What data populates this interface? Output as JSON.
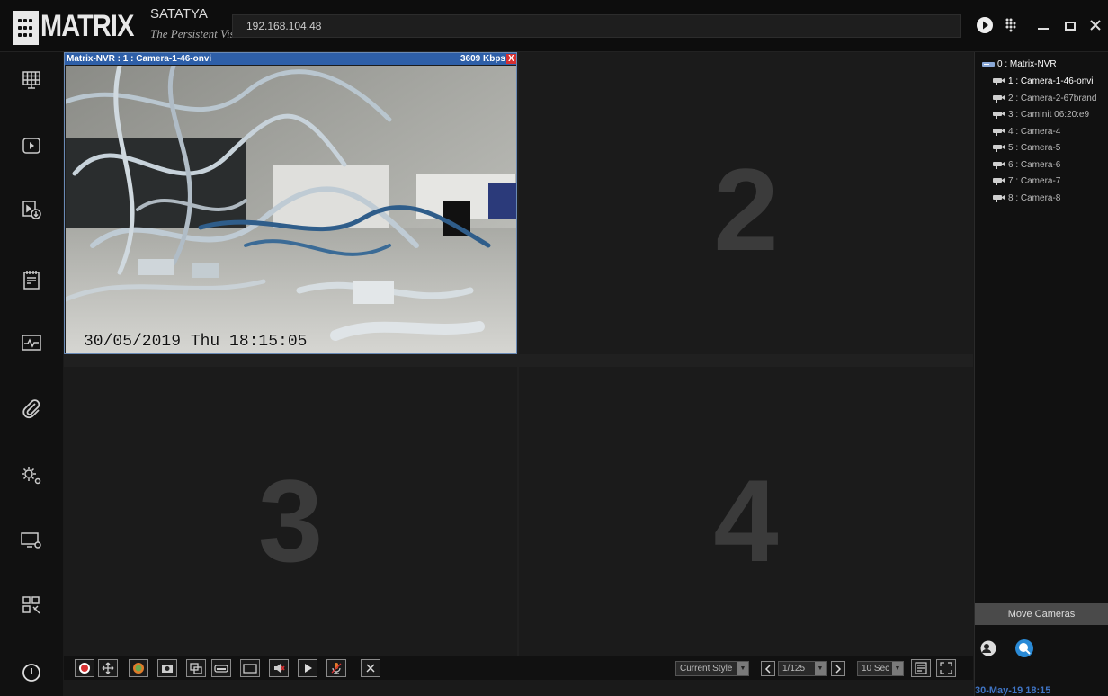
{
  "header": {
    "brand": "SATATYA",
    "tagline": "The Persistent Vision",
    "logo": "MATRIX",
    "address": "192.168.104.48",
    "icons": [
      "play-icon",
      "grid-dots-icon",
      "minimize-icon",
      "restore-icon",
      "close-icon"
    ]
  },
  "sidebar": {
    "items": [
      "live-view-icon",
      "playback-icon",
      "video-download-icon",
      "event-log-icon",
      "system-health-icon",
      "attachment-icon",
      "settings-icon",
      "display-settings-icon",
      "layout-tools-icon",
      "power-icon"
    ]
  },
  "tiles": {
    "t1": {
      "title": "Matrix-NVR : 1 : Camera-1-46-onvi",
      "kbps": "3609 Kbps",
      "close": "X",
      "timestamp": "30/05/2019 Thu 18:15:05"
    },
    "t2": "2",
    "t3": "3",
    "t4": "4"
  },
  "toolbar": {
    "style_select": "Current Style",
    "page": "1/125",
    "interval": "10 Sec",
    "buttons": [
      "record-icon",
      "ptz-icon",
      "color-icon",
      "snapshot-icon",
      "sequence-icon",
      "instant-playback-icon",
      "full-view-icon",
      "mute-icon",
      "play-icon",
      "microphone-icon",
      "close-icon"
    ]
  },
  "tree": {
    "root": "0 : Matrix-NVR",
    "cameras": [
      "1 : Camera-1-46-onvi",
      "2 : Camera-2-67brand",
      "3 : CamInit 06:20:e9",
      "4 : Camera-4",
      "5 : Camera-5",
      "6 : Camera-6",
      "7 : Camera-7",
      "8 : Camera-8"
    ]
  },
  "rpanel": {
    "move_cameras": "Move Cameras",
    "date": "30-May-19 18:15"
  },
  "colors": {
    "accent": "#2e5fa8",
    "record": "#d63031",
    "date": "#3f74c4"
  }
}
